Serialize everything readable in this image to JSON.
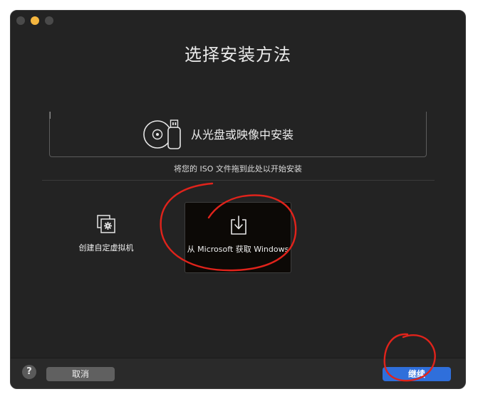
{
  "window": {
    "title": "选择安装方法"
  },
  "install_options": {
    "disc_label": "从光盘或映像中安装",
    "drag_hint": "将您的 ISO 文件拖到此处以开始安装",
    "custom_vm_label": "创建自定虚拟机",
    "microsoft_label": "从 Microsoft 获取 Windows"
  },
  "footer": {
    "help_label": "?",
    "cancel_label": "取消",
    "continue_label": "继续"
  },
  "colors": {
    "window_bg": "#232323",
    "accent": "#2f6fdb",
    "annotation": "#e0231b"
  }
}
